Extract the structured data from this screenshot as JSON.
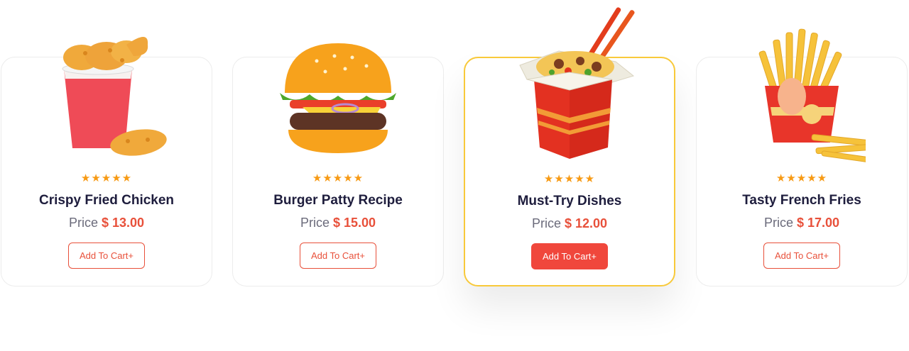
{
  "colors": {
    "accent": "#e8503a",
    "star": "#f79a14",
    "title": "#1e1d3d",
    "active_border": "#f8c93a"
  },
  "products": [
    {
      "title": "Crispy Fried Chicken",
      "rating": 5,
      "stars": "★★★★★",
      "price_label": "Price",
      "price": "$ 13.00",
      "button_label": "Add To Cart+",
      "image_icon": "fried-chicken-bucket-icon",
      "active": false
    },
    {
      "title": "Burger Patty Recipe",
      "rating": 5,
      "stars": "★★★★★",
      "price_label": "Price",
      "price": "$ 15.00",
      "button_label": "Add To Cart+",
      "image_icon": "burger-icon",
      "active": false
    },
    {
      "title": "Must-Try Dishes",
      "rating": 5,
      "stars": "★★★★★",
      "price_label": "Price",
      "price": "$ 12.00",
      "button_label": "Add To Cart+",
      "image_icon": "noodle-box-icon",
      "active": true
    },
    {
      "title": "Tasty French Fries",
      "rating": 5,
      "stars": "★★★★★",
      "price_label": "Price",
      "price": "$ 17.00",
      "button_label": "Add To Cart+",
      "image_icon": "french-fries-icon",
      "active": false
    }
  ]
}
